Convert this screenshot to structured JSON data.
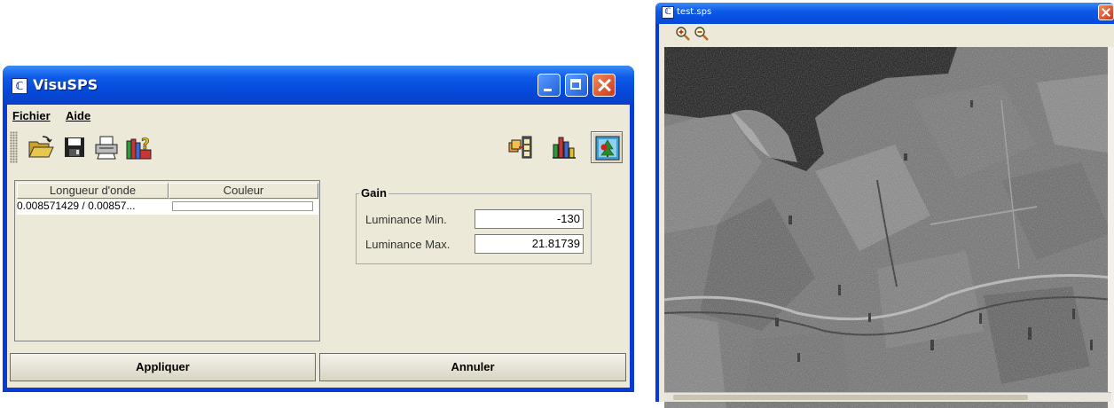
{
  "main_window": {
    "title": "VisuSPS",
    "app_icon": "ℂ",
    "menu": [
      "Fichier",
      "Aide"
    ],
    "toolbar_left": [
      "open-folder-icon",
      "save-icon",
      "print-icon",
      "library-help-icon"
    ],
    "toolbar_right": [
      "layers-film-icon",
      "bar-chart-icon",
      "image-tree-icon"
    ],
    "table": {
      "columns": [
        "Longueur d'onde",
        "Couleur"
      ],
      "rows": [
        {
          "wavelength": "0.008571429 / 0.00857...",
          "color": ""
        }
      ]
    },
    "gain": {
      "legend": "Gain",
      "min_label": "Luminance Min.",
      "min_value": "-130",
      "max_label": "Luminance Max.",
      "max_value": "21.81739"
    },
    "apply_label": "Appliquer",
    "cancel_label": "Annuler"
  },
  "image_window": {
    "title": "test.sps",
    "app_icon": "ℂ",
    "tools": [
      "zoom-in-icon",
      "zoom-out-icon"
    ]
  },
  "colors": {
    "xp_blue": "#0a3ad6",
    "dialog_bg": "#ece9d8",
    "close_red": "#d0361a"
  }
}
